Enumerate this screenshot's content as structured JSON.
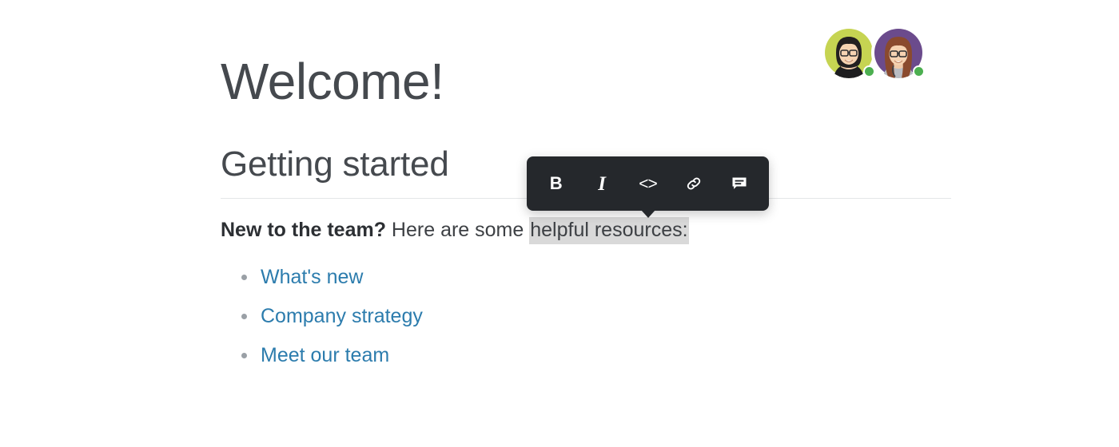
{
  "document": {
    "title": "Welcome!",
    "section_heading": "Getting started",
    "paragraph": {
      "bold_lead": "New to the team?",
      "middle": " Here are some ",
      "selected": "helpful resources:"
    },
    "links": [
      {
        "label": "What's new"
      },
      {
        "label": "Company strategy"
      },
      {
        "label": "Meet our team"
      }
    ]
  },
  "toolbar": {
    "buttons": [
      {
        "name": "bold",
        "glyph": "B",
        "tooltip": "Bold"
      },
      {
        "name": "italic",
        "glyph": "I",
        "tooltip": "Italic"
      },
      {
        "name": "code",
        "glyph": "<>",
        "tooltip": "Code"
      },
      {
        "name": "link",
        "glyph": "",
        "tooltip": "Link"
      },
      {
        "name": "comment",
        "glyph": "",
        "tooltip": "Comment"
      }
    ]
  },
  "presence": {
    "avatars": [
      {
        "name": "avatar-1",
        "background": "#c6d452",
        "status": "online",
        "status_color": "#4caf50"
      },
      {
        "name": "avatar-2",
        "background": "#6b4b8c",
        "status": "online",
        "status_color": "#4caf50"
      }
    ]
  },
  "colors": {
    "heading": "#45494e",
    "body_text": "#3d4044",
    "link": "#2c7cad",
    "selection_highlight": "#d9d9d9",
    "toolbar_bg": "#25282c",
    "rule": "#e4e6e8",
    "bullet": "#9aa0a6",
    "page_bg": "#ffffff"
  }
}
